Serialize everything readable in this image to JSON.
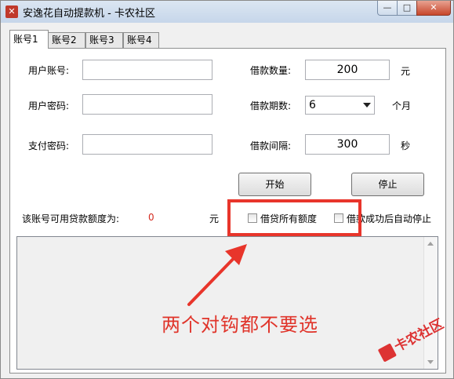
{
  "window": {
    "title": "安逸花自动提款机 - 卡农社区",
    "minimize_icon": "—",
    "maximize_icon": "□",
    "close_icon": "✕"
  },
  "tabs": [
    {
      "label": "账号1",
      "active": true
    },
    {
      "label": "账号2",
      "active": false
    },
    {
      "label": "账号3",
      "active": false
    },
    {
      "label": "账号4",
      "active": false
    }
  ],
  "form": {
    "user_account_label": "用户账号:",
    "user_account_value": "",
    "user_password_label": "用户密码:",
    "user_password_value": "",
    "pay_password_label": "支付密码:",
    "pay_password_value": "",
    "loan_amount_label": "借款数量:",
    "loan_amount_value": "200",
    "loan_amount_unit": "元",
    "loan_term_label": "借款期数:",
    "loan_term_value": "6",
    "loan_term_unit": "个月",
    "loan_interval_label": "借款间隔:",
    "loan_interval_value": "300",
    "loan_interval_unit": "秒"
  },
  "buttons": {
    "start": "开始",
    "stop": "停止"
  },
  "credit": {
    "label": "该账号可用贷款额度为:",
    "value": "0",
    "unit": "元",
    "value_color": "#d42a1f"
  },
  "checkboxes": {
    "borrow_all_label": "借贷所有额度",
    "borrow_all_checked": false,
    "auto_stop_label": "借款成功后自动停止",
    "auto_stop_checked": false
  },
  "log": {
    "content": ""
  },
  "annotation": {
    "text": "两个对钩都不要选",
    "color": "#e0342a"
  },
  "watermark": {
    "text": "卡农社区"
  }
}
